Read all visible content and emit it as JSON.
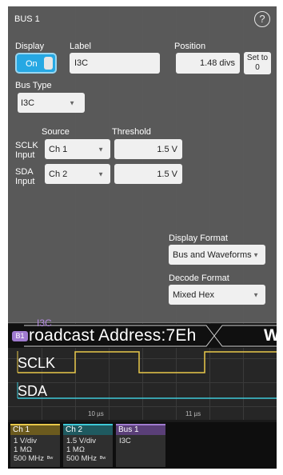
{
  "panel": {
    "title": "BUS 1",
    "help_icon": "?",
    "display_label": "Display",
    "display_value": "On",
    "label_label": "Label",
    "label_value": "I3C",
    "position_label": "Position",
    "position_value": "1.48 divs",
    "set_to_zero": "Set to 0",
    "bus_type_label": "Bus Type",
    "bus_type_value": "I3C",
    "source_header": "Source",
    "threshold_header": "Threshold",
    "sclk_label": "SCLK Input",
    "sclk_source": "Ch 1",
    "sclk_threshold": "1.5 V",
    "sda_label": "SDA Input",
    "sda_source": "Ch 2",
    "sda_threshold": "1.5 V",
    "display_format_label": "Display Format",
    "display_format_value": "Bus and Waveforms",
    "decode_format_label": "Decode Format",
    "decode_format_value": "Mixed Hex"
  },
  "waveform": {
    "bus_badge": "B1",
    "bus_tag": "I3C",
    "decode_text": "roadcast Address:7Eh",
    "decode_next": "W",
    "sclk_label": "SCLK",
    "sda_label": "SDA",
    "time_ticks": [
      "10 µs",
      "11 µs"
    ]
  },
  "channels": [
    {
      "name": "Ch 1",
      "color": "#e8c84a",
      "lines": [
        "1 V/div",
        "1 MΩ",
        "500 MHz"
      ],
      "bw_icon": "bandwidth-limit-icon"
    },
    {
      "name": "Ch 2",
      "color": "#3ec9d8",
      "lines": [
        "1.5 V/div",
        "1 MΩ",
        "500 MHz"
      ],
      "bw_icon": "bandwidth-limit-icon"
    },
    {
      "name": "Bus 1",
      "color": "#a07bd0",
      "lines": [
        "I3C"
      ]
    }
  ]
}
